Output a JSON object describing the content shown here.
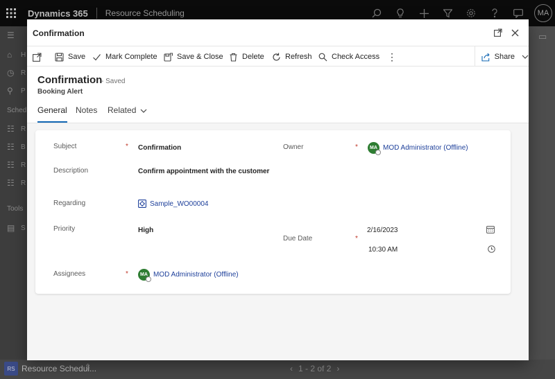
{
  "app": {
    "title": "Dynamics 365",
    "area": "Resource Scheduling",
    "user_initials": "MA"
  },
  "background": {
    "bottom_badge": "RS",
    "bottom_name": "Resource Schedul...",
    "pager": "1 - 2 of 2",
    "nav_letters": [
      "H",
      "R",
      "P",
      "Schedu",
      "R",
      "B",
      "R",
      "R",
      "Tools",
      "S"
    ]
  },
  "dialog": {
    "title": "Confirmation",
    "commands": {
      "save": "Save",
      "mark_complete": "Mark Complete",
      "save_close": "Save & Close",
      "delete": "Delete",
      "refresh": "Refresh",
      "check_access": "Check Access",
      "more": "⋮",
      "share": "Share"
    },
    "record": {
      "title": "Confirmation",
      "status": "- Saved",
      "entity": "Booking Alert"
    },
    "tabs": {
      "general": "General",
      "notes": "Notes",
      "related": "Related"
    },
    "form": {
      "subject_label": "Subject",
      "subject_value": "Confirmation",
      "description_label": "Description",
      "description_value": "Confirm appointment with the customer",
      "regarding_label": "Regarding",
      "regarding_value": "Sample_WO00004",
      "priority_label": "Priority",
      "priority_value": "High",
      "assignees_label": "Assignees",
      "assignees_value": "MOD Administrator (Offline)",
      "owner_label": "Owner",
      "owner_value": "MOD Administrator (Offline)",
      "due_date_label": "Due Date",
      "due_date_value": "2/16/2023",
      "due_time_value": "10:30 AM",
      "required_mark": "*",
      "avatar_initials": "MA"
    }
  },
  "colors": {
    "accent": "#1267b4",
    "link": "#1d3f9a",
    "required": "#c0392b",
    "avatar": "#2e7d32"
  }
}
